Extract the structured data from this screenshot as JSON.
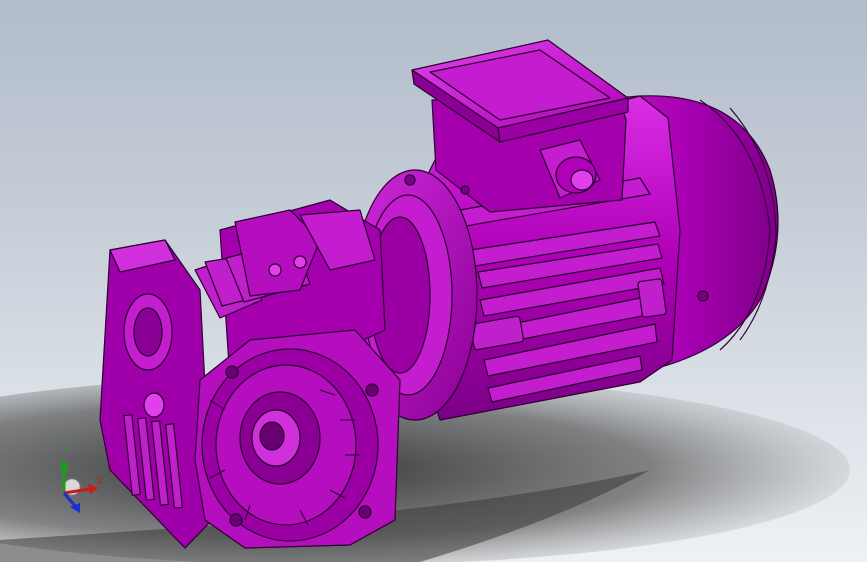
{
  "viewport": {
    "background_top": "#b2bcca",
    "background_bottom": "#eef1f4",
    "model_color": "#b000b8",
    "model_highlight": "#e63ff0",
    "model_shadow": "#5e006a",
    "edge_color": "#2a002e"
  },
  "triad": {
    "x_label": "X",
    "y_label": "Y",
    "x_color": "#d01818",
    "y_color": "#18a018",
    "z_color": "#1830d0"
  }
}
